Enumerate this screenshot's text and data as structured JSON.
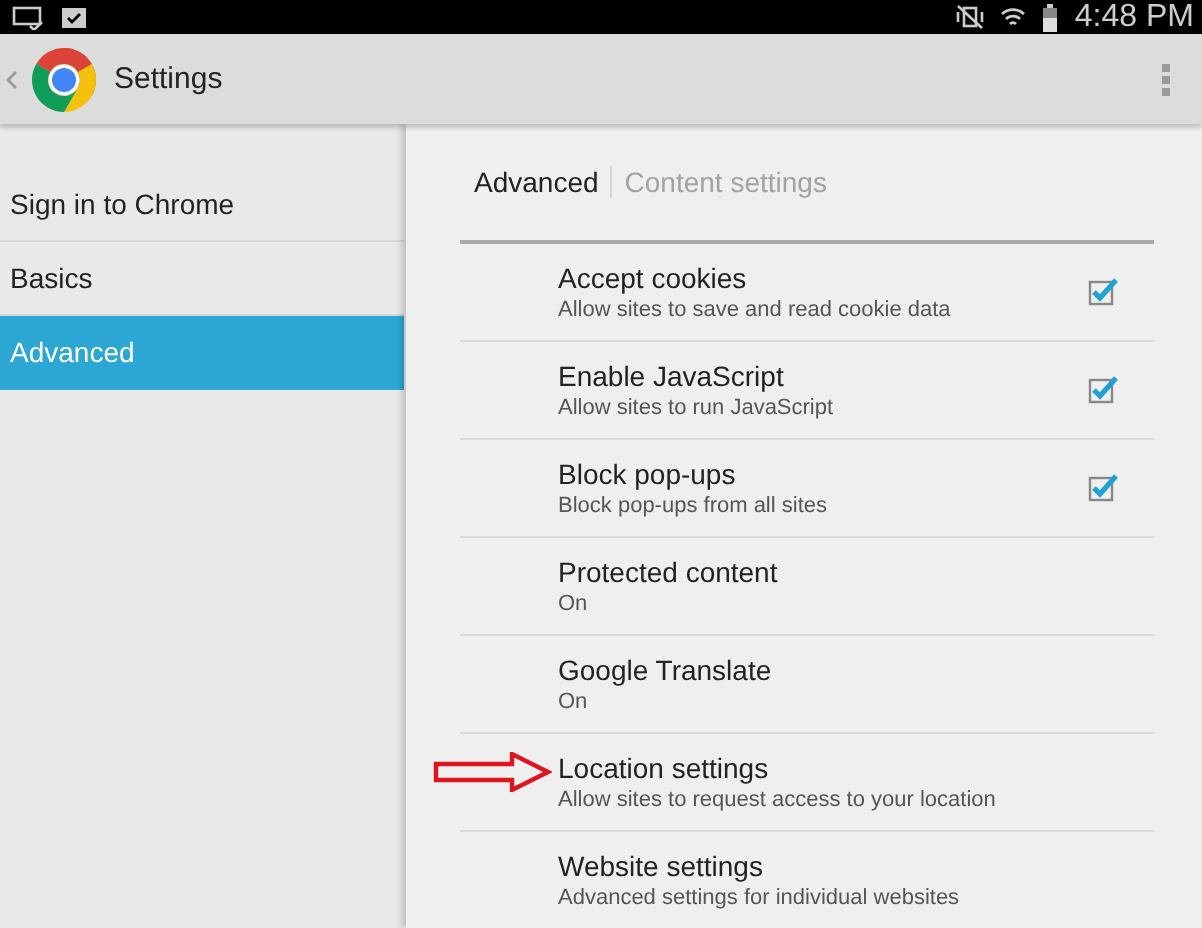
{
  "status_bar": {
    "time": "4:48 PM"
  },
  "app_bar": {
    "title": "Settings"
  },
  "sidebar": {
    "items": [
      {
        "label": "Sign in to Chrome",
        "selected": false
      },
      {
        "label": "Basics",
        "selected": false
      },
      {
        "label": "Advanced",
        "selected": true
      }
    ]
  },
  "breadcrumb": [
    {
      "label": "Advanced",
      "selected": true
    },
    {
      "label": "Content settings",
      "selected": false
    }
  ],
  "settings": [
    {
      "kind": "checkbox",
      "title": "Accept cookies",
      "summary": "Allow sites to save and read cookie data",
      "checked": true,
      "highlighted": false
    },
    {
      "kind": "checkbox",
      "title": "Enable JavaScript",
      "summary": "Allow sites to run JavaScript",
      "checked": true,
      "highlighted": false
    },
    {
      "kind": "checkbox",
      "title": "Block pop-ups",
      "summary": "Block pop-ups from all sites",
      "checked": true,
      "highlighted": false
    },
    {
      "kind": "plain",
      "title": "Protected content",
      "summary": "On",
      "highlighted": false
    },
    {
      "kind": "plain",
      "title": "Google Translate",
      "summary": "On",
      "highlighted": false
    },
    {
      "kind": "plain",
      "title": "Location settings",
      "summary": "Allow sites to request access to your location",
      "highlighted": true
    },
    {
      "kind": "plain",
      "title": "Website settings",
      "summary": "Advanced settings for individual websites",
      "highlighted": false
    }
  ]
}
